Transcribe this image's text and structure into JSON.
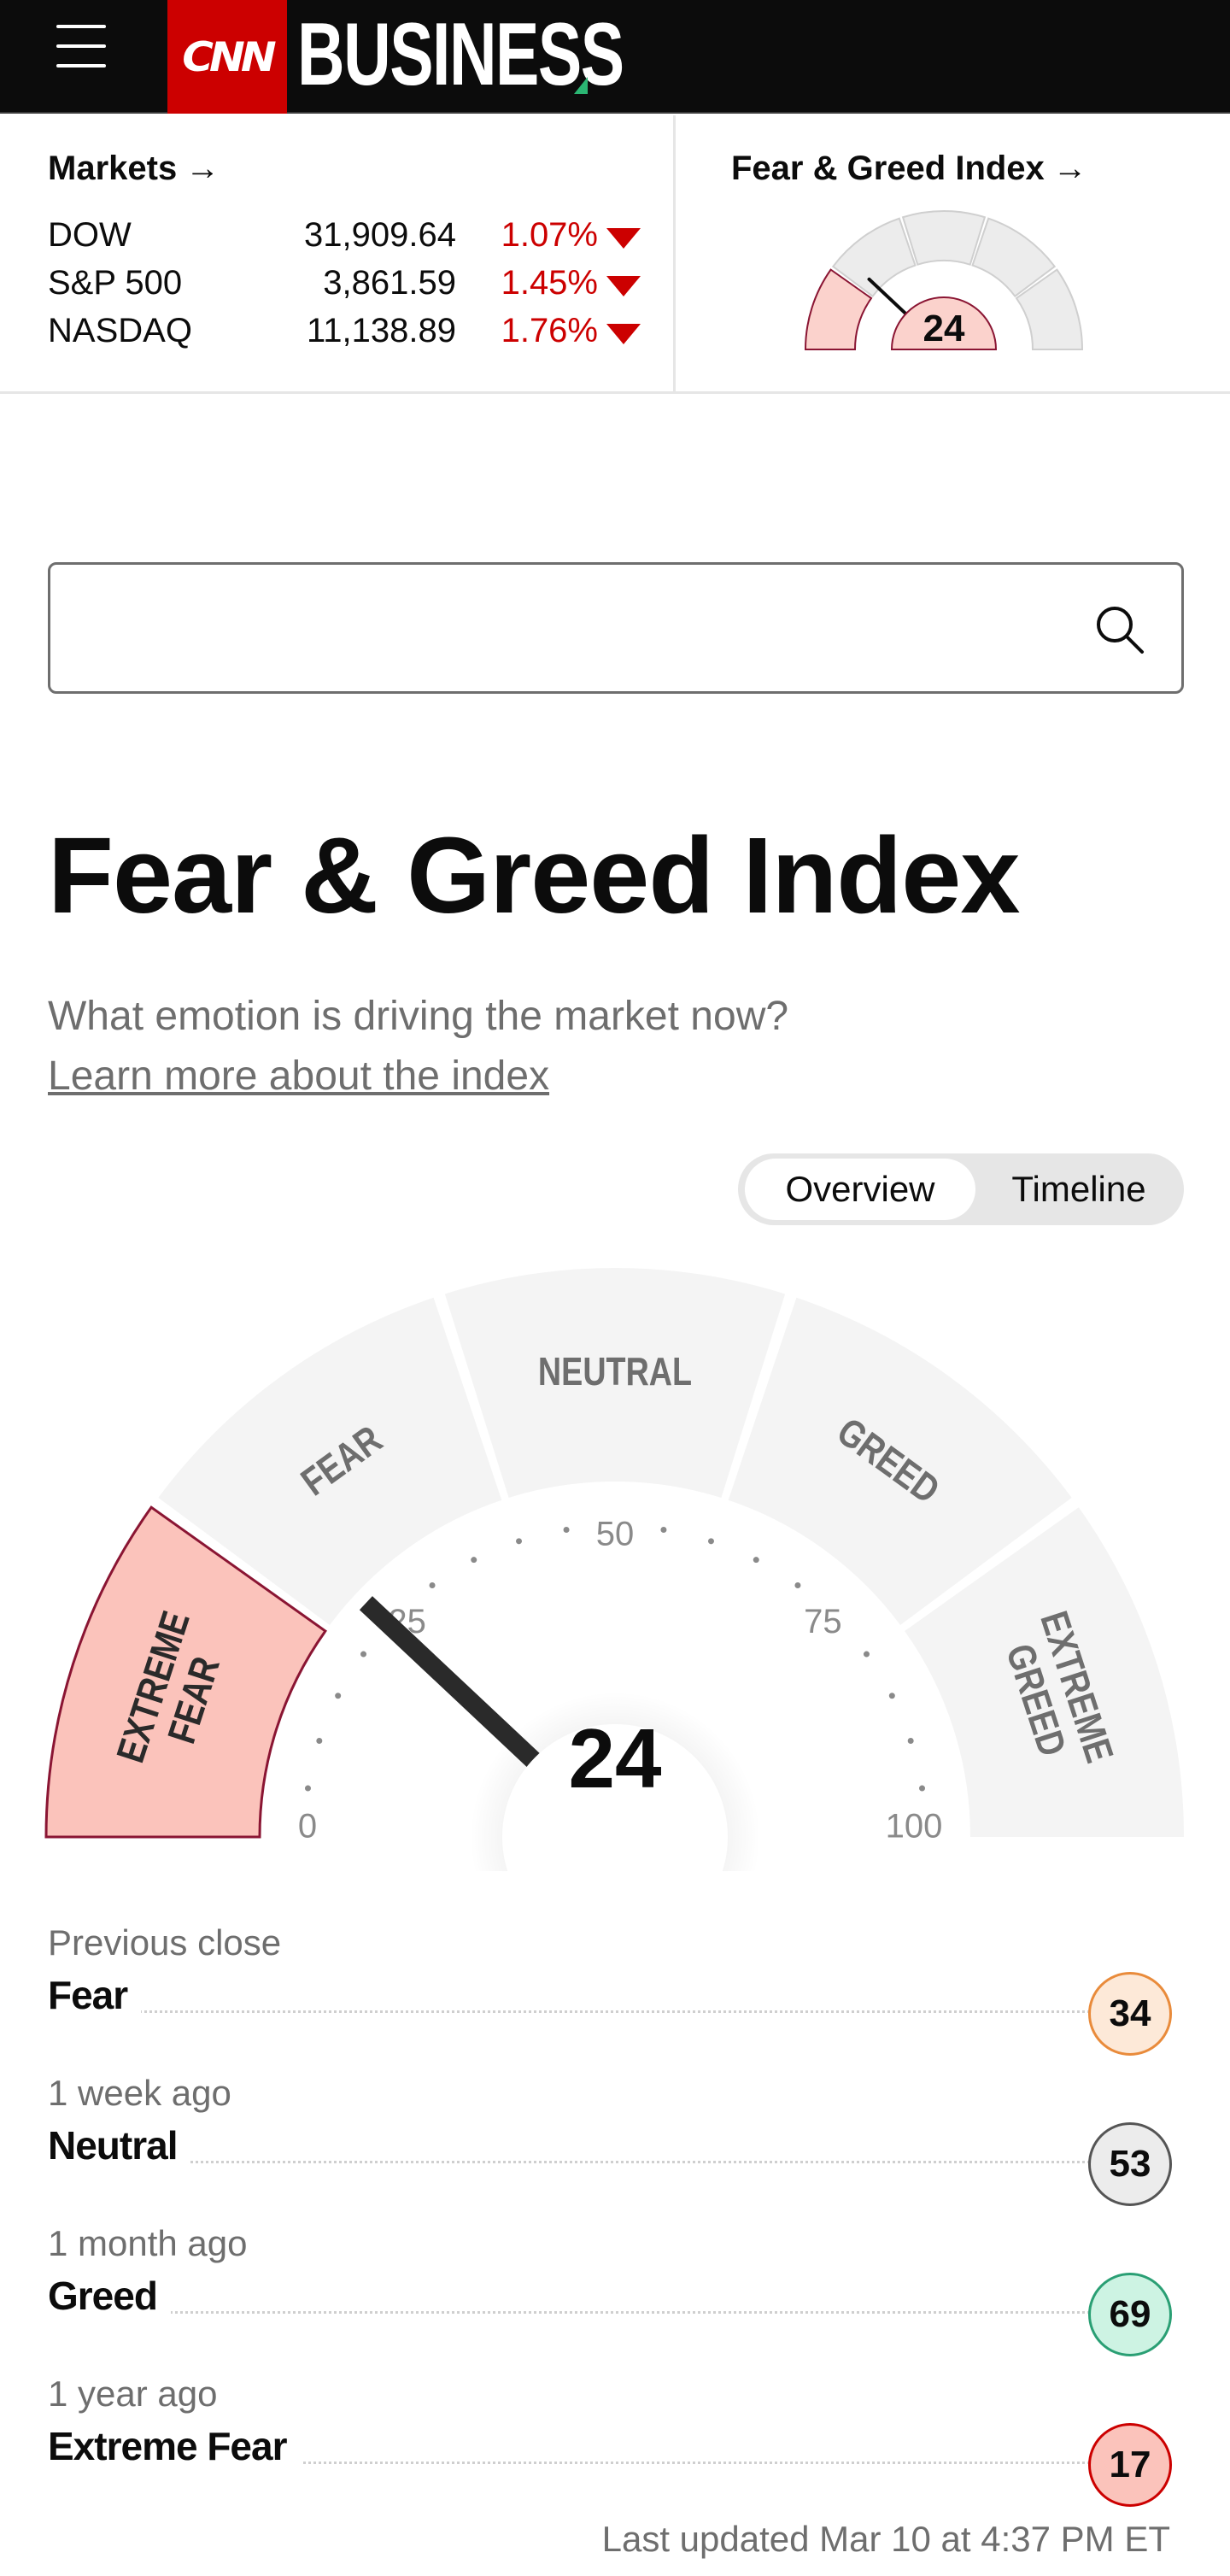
{
  "header": {
    "logo_text": "CNN",
    "brand": "BUSINESS"
  },
  "markets": {
    "title": "Markets",
    "title_arrow": "→",
    "indices": [
      {
        "name": "DOW",
        "value": "31,909.64",
        "change": "1.07%"
      },
      {
        "name": "S&P 500",
        "value": "3,861.59",
        "change": "1.45%"
      },
      {
        "name": "NASDAQ",
        "value": "11,138.89",
        "change": "1.76%"
      }
    ],
    "down_color": "#cc0000"
  },
  "fear_greed_widget": {
    "title": "Fear & Greed Index",
    "title_arrow": "→",
    "value": "24"
  },
  "search": {
    "placeholder": "",
    "value": ""
  },
  "page": {
    "title": "Fear & Greed Index",
    "subtitle": "What emotion is driving the market now?",
    "learn_more": "Learn more about the index"
  },
  "toggle": {
    "options": [
      "Overview",
      "Timeline"
    ],
    "selected": "Overview"
  },
  "gauge": {
    "value": 24,
    "value_text": "24",
    "segments": [
      {
        "label_lines": [
          "EXTREME",
          "FEAR"
        ],
        "active": true
      },
      {
        "label_lines": [
          "FEAR"
        ],
        "active": false
      },
      {
        "label_lines": [
          "NEUTRAL"
        ],
        "active": false
      },
      {
        "label_lines": [
          "GREED"
        ],
        "active": false
      },
      {
        "label_lines": [
          "EXTREME",
          "GREED"
        ],
        "active": false
      }
    ],
    "scale_labels": [
      "0",
      "25",
      "50",
      "75",
      "100"
    ],
    "active_fill": "#fbc3bb",
    "active_stroke": "#8a1533",
    "inactive_fill": "#f4f4f4"
  },
  "history": [
    {
      "when": "Previous close",
      "label": "Fear",
      "value": "34",
      "badge_bg": "#fde9d8",
      "badge_border": "#e98b3b"
    },
    {
      "when": "1 week ago",
      "label": "Neutral",
      "value": "53",
      "badge_bg": "#ececec",
      "badge_border": "#555555"
    },
    {
      "when": "1 month ago",
      "label": "Greed",
      "value": "69",
      "badge_bg": "#cdf3e3",
      "badge_border": "#2a9f74"
    },
    {
      "when": "1 year ago",
      "label": "Extreme Fear",
      "value": "17",
      "badge_bg": "#fbc3bb",
      "badge_border": "#cc0000"
    }
  ],
  "last_updated": "Last updated Mar 10 at 4:37 PM ET"
}
